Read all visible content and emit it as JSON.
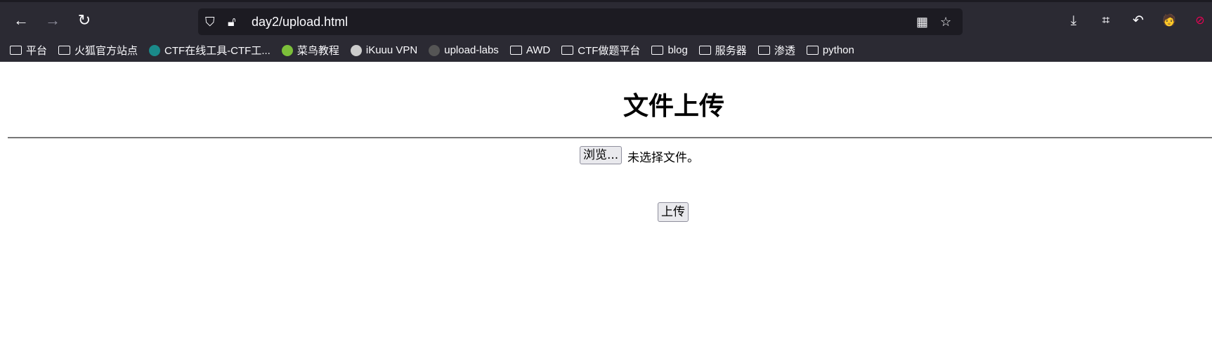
{
  "browser": {
    "url": "day2/upload.html",
    "bookmarks": [
      {
        "label": "平台",
        "icon": "folder-icon"
      },
      {
        "label": "火狐官方站点",
        "icon": "folder-icon"
      },
      {
        "label": "CTF在线工具-CTF工...",
        "icon": "ctf-favicon"
      },
      {
        "label": "菜鸟教程",
        "icon": "runoob-favicon"
      },
      {
        "label": "iKuuu VPN",
        "icon": "ikuuu-favicon"
      },
      {
        "label": "upload-labs",
        "icon": "upload-labs-favicon"
      },
      {
        "label": "AWD",
        "icon": "folder-icon"
      },
      {
        "label": "CTF做题平台",
        "icon": "folder-icon"
      },
      {
        "label": "blog",
        "icon": "folder-icon"
      },
      {
        "label": "服务器",
        "icon": "folder-icon"
      },
      {
        "label": "渗透",
        "icon": "folder-icon"
      },
      {
        "label": "python",
        "icon": "folder-icon"
      }
    ]
  },
  "page": {
    "title": "文件上传",
    "browse_label": "浏览...",
    "no_file_text": "未选择文件。",
    "upload_label": "上传"
  }
}
